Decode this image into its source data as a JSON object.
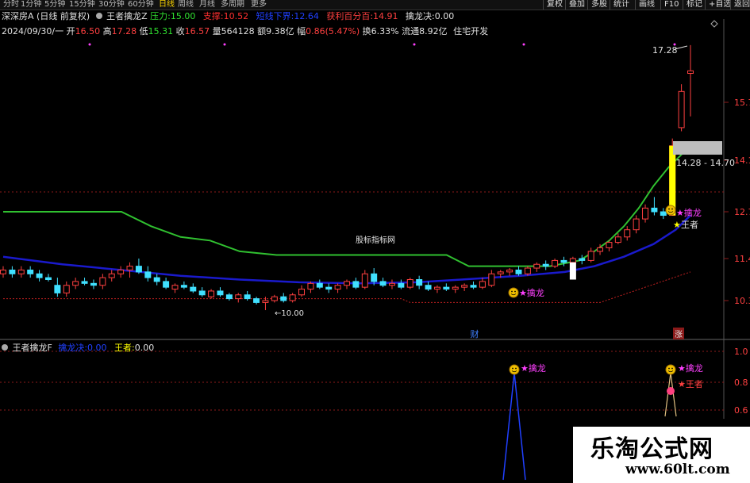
{
  "toolbar": {
    "timeframes": [
      "分时",
      "1分钟",
      "5分钟",
      "15分钟",
      "30分钟",
      "60分钟",
      "日线",
      "周线",
      "月线",
      "多周期",
      "更多"
    ],
    "active": "日线",
    "right_buttons": [
      "复权",
      "叠加",
      "多股",
      "统计",
      "画线",
      "F10",
      "标记",
      "+自选",
      "返回"
    ]
  },
  "header": {
    "stock": "深深房A",
    "mode": "(日线 前复权)",
    "indicator": "王者擒龙Z",
    "pressure_label": "压力:",
    "pressure": "15.00",
    "support_label": "支撑:",
    "support": "10.52",
    "blue_label": "短线下界:",
    "blue": "12.64",
    "profit_label": "获利百分百:",
    "profit": "14.91",
    "qinlong_label": "擒龙决:",
    "qinlong": "0.00"
  },
  "info": {
    "date": "2024/09/30/一",
    "open_label": "开",
    "open": "16.50",
    "high_label": "高",
    "high": "17.28",
    "low_label": "低",
    "low": "15.31",
    "close_label": "收",
    "close": "16.57",
    "vol_label": "量",
    "vol": "564128",
    "amt_label": "额",
    "amt": "9.38亿",
    "chg_label": "幅",
    "chg": "0.86(5.47%)",
    "turn_label": "换",
    "turn": "6.33%",
    "float_label": "流通",
    "float": "8.92亿",
    "sector": "住宅开发"
  },
  "sub_header": {
    "name": "王者擒龙F",
    "qinlong_label": "擒龙决:",
    "qinlong": "0.00",
    "king_label": "王者:",
    "king": "0.00"
  },
  "labels": {
    "high_mark": "17.28",
    "low_mark": "10.00",
    "range": "14.28 - 14.70",
    "watermark_center": "股标指标网",
    "signal_qinlong": "擒龙",
    "signal_king": "王者",
    "cai": "财",
    "zhang": "涨"
  },
  "watermark": {
    "cn": "乐淘公式网",
    "url": "www.60lt.com"
  },
  "colors": {
    "up": "#ff4040",
    "down": "#40e0ff",
    "green_line": "#30c030",
    "blue_line": "#1a1acc",
    "yellow": "#ffff00",
    "magenta": "#ff40ff"
  },
  "chart_data": [
    {
      "type": "candlestick",
      "title": "深深房A (日线 前复权)",
      "y_ticks": [
        10.3,
        11.4,
        12.7,
        14.1,
        15.7
      ],
      "ylim": [
        9.9,
        17.6
      ],
      "grid": false,
      "candles": [
        {
          "o": 11.0,
          "h": 11.2,
          "l": 10.9,
          "c": 11.1
        },
        {
          "o": 11.1,
          "h": 11.2,
          "l": 10.9,
          "c": 11.0
        },
        {
          "o": 11.0,
          "h": 11.2,
          "l": 10.9,
          "c": 11.1
        },
        {
          "o": 11.1,
          "h": 11.2,
          "l": 10.9,
          "c": 11.0
        },
        {
          "o": 11.0,
          "h": 11.1,
          "l": 10.8,
          "c": 10.9
        },
        {
          "o": 10.9,
          "h": 11.0,
          "l": 10.8,
          "c": 10.85
        },
        {
          "o": 10.7,
          "h": 10.9,
          "l": 10.4,
          "c": 10.5
        },
        {
          "o": 10.5,
          "h": 10.8,
          "l": 10.4,
          "c": 10.7
        },
        {
          "o": 10.7,
          "h": 10.9,
          "l": 10.6,
          "c": 10.8
        },
        {
          "o": 10.8,
          "h": 10.9,
          "l": 10.7,
          "c": 10.75
        },
        {
          "o": 10.75,
          "h": 10.85,
          "l": 10.6,
          "c": 10.7
        },
        {
          "o": 10.7,
          "h": 11.0,
          "l": 10.6,
          "c": 10.9
        },
        {
          "o": 10.9,
          "h": 11.1,
          "l": 10.8,
          "c": 11.0
        },
        {
          "o": 11.0,
          "h": 11.2,
          "l": 10.9,
          "c": 11.1
        },
        {
          "o": 11.1,
          "h": 11.3,
          "l": 10.9,
          "c": 11.2
        },
        {
          "o": 11.2,
          "h": 11.4,
          "l": 11.0,
          "c": 11.05
        },
        {
          "o": 11.05,
          "h": 11.2,
          "l": 10.8,
          "c": 10.9
        },
        {
          "o": 10.9,
          "h": 11.0,
          "l": 10.7,
          "c": 10.8
        },
        {
          "o": 10.8,
          "h": 10.9,
          "l": 10.6,
          "c": 10.65
        },
        {
          "o": 10.6,
          "h": 10.75,
          "l": 10.5,
          "c": 10.7
        },
        {
          "o": 10.7,
          "h": 10.8,
          "l": 10.6,
          "c": 10.65
        },
        {
          "o": 10.65,
          "h": 10.75,
          "l": 10.5,
          "c": 10.55
        },
        {
          "o": 10.55,
          "h": 10.65,
          "l": 10.4,
          "c": 10.45
        },
        {
          "o": 10.4,
          "h": 10.6,
          "l": 10.35,
          "c": 10.55
        },
        {
          "o": 10.55,
          "h": 10.65,
          "l": 10.4,
          "c": 10.45
        },
        {
          "o": 10.45,
          "h": 10.5,
          "l": 10.3,
          "c": 10.35
        },
        {
          "o": 10.35,
          "h": 10.5,
          "l": 10.25,
          "c": 10.45
        },
        {
          "o": 10.45,
          "h": 10.55,
          "l": 10.3,
          "c": 10.35
        },
        {
          "o": 10.35,
          "h": 10.4,
          "l": 10.2,
          "c": 10.25
        },
        {
          "o": 10.25,
          "h": 10.4,
          "l": 10.05,
          "c": 10.3
        },
        {
          "o": 10.3,
          "h": 10.45,
          "l": 10.25,
          "c": 10.4
        },
        {
          "o": 10.4,
          "h": 10.5,
          "l": 10.25,
          "c": 10.3
        },
        {
          "o": 10.3,
          "h": 10.5,
          "l": 10.25,
          "c": 10.45
        },
        {
          "o": 10.45,
          "h": 10.7,
          "l": 10.4,
          "c": 10.6
        },
        {
          "o": 10.6,
          "h": 10.8,
          "l": 10.5,
          "c": 10.75
        },
        {
          "o": 10.75,
          "h": 10.85,
          "l": 10.6,
          "c": 10.65
        },
        {
          "o": 10.65,
          "h": 10.75,
          "l": 10.5,
          "c": 10.6
        },
        {
          "o": 10.6,
          "h": 10.75,
          "l": 10.5,
          "c": 10.7
        },
        {
          "o": 10.7,
          "h": 10.85,
          "l": 10.6,
          "c": 10.8
        },
        {
          "o": 10.8,
          "h": 10.9,
          "l": 10.6,
          "c": 10.65
        },
        {
          "o": 10.65,
          "h": 11.1,
          "l": 10.6,
          "c": 11.0
        },
        {
          "o": 11.0,
          "h": 11.15,
          "l": 10.7,
          "c": 10.8
        },
        {
          "o": 10.8,
          "h": 10.9,
          "l": 10.65,
          "c": 10.7
        },
        {
          "o": 10.7,
          "h": 10.85,
          "l": 10.6,
          "c": 10.75
        },
        {
          "o": 10.75,
          "h": 10.85,
          "l": 10.6,
          "c": 10.65
        },
        {
          "o": 10.65,
          "h": 10.9,
          "l": 10.6,
          "c": 10.85
        },
        {
          "o": 10.85,
          "h": 10.95,
          "l": 10.6,
          "c": 10.7
        },
        {
          "o": 10.7,
          "h": 10.8,
          "l": 10.55,
          "c": 10.6
        },
        {
          "o": 10.6,
          "h": 10.7,
          "l": 10.5,
          "c": 10.65
        },
        {
          "o": 10.65,
          "h": 10.75,
          "l": 10.55,
          "c": 10.6
        },
        {
          "o": 10.6,
          "h": 10.7,
          "l": 10.5,
          "c": 10.65
        },
        {
          "o": 10.65,
          "h": 10.75,
          "l": 10.55,
          "c": 10.7
        },
        {
          "o": 10.7,
          "h": 10.8,
          "l": 10.6,
          "c": 10.65
        },
        {
          "o": 10.65,
          "h": 10.9,
          "l": 10.6,
          "c": 10.8
        },
        {
          "o": 10.7,
          "h": 11.1,
          "l": 10.65,
          "c": 11.0
        },
        {
          "o": 11.0,
          "h": 11.1,
          "l": 10.9,
          "c": 11.05
        },
        {
          "o": 11.05,
          "h": 11.15,
          "l": 10.95,
          "c": 11.1
        },
        {
          "o": 11.1,
          "h": 11.2,
          "l": 10.95,
          "c": 11.0
        },
        {
          "o": 11.0,
          "h": 11.2,
          "l": 10.95,
          "c": 11.15
        },
        {
          "o": 11.15,
          "h": 11.3,
          "l": 11.05,
          "c": 11.25
        },
        {
          "o": 11.25,
          "h": 11.35,
          "l": 11.1,
          "c": 11.2
        },
        {
          "o": 11.2,
          "h": 11.4,
          "l": 11.15,
          "c": 11.35
        },
        {
          "o": 11.35,
          "h": 11.45,
          "l": 11.2,
          "c": 11.3
        },
        {
          "o": 11.3,
          "h": 11.45,
          "l": 11.2,
          "c": 11.4
        },
        {
          "o": 11.4,
          "h": 11.5,
          "l": 11.25,
          "c": 11.35
        },
        {
          "o": 11.35,
          "h": 11.7,
          "l": 11.3,
          "c": 11.6
        },
        {
          "o": 11.6,
          "h": 11.8,
          "l": 11.5,
          "c": 11.7
        },
        {
          "o": 11.7,
          "h": 11.9,
          "l": 11.6,
          "c": 11.85
        },
        {
          "o": 11.85,
          "h": 12.1,
          "l": 11.8,
          "c": 12.0
        },
        {
          "o": 12.0,
          "h": 12.3,
          "l": 11.9,
          "c": 12.2
        },
        {
          "o": 12.2,
          "h": 12.6,
          "l": 12.1,
          "c": 12.5
        },
        {
          "o": 12.5,
          "h": 12.9,
          "l": 12.4,
          "c": 12.8
        },
        {
          "o": 12.8,
          "h": 13.1,
          "l": 12.6,
          "c": 12.7
        },
        {
          "o": 12.7,
          "h": 12.8,
          "l": 12.5,
          "c": 12.6
        },
        {
          "o": 12.6,
          "h": 14.7,
          "l": 12.6,
          "c": 14.5
        },
        {
          "o": 15.0,
          "h": 16.2,
          "l": 14.9,
          "c": 16.0
        },
        {
          "o": 16.5,
          "h": 17.28,
          "l": 15.31,
          "c": 16.57
        }
      ],
      "annotations": [
        "17.28",
        "10.00",
        "14.28 - 14.70",
        "擒龙",
        "王者",
        "财",
        "涨"
      ]
    },
    {
      "type": "line",
      "title": "王者擒龙F",
      "y_ticks": [
        0.6,
        0.8,
        1.0
      ],
      "ylim": [
        0.5,
        1.1
      ],
      "grid": true
    }
  ]
}
